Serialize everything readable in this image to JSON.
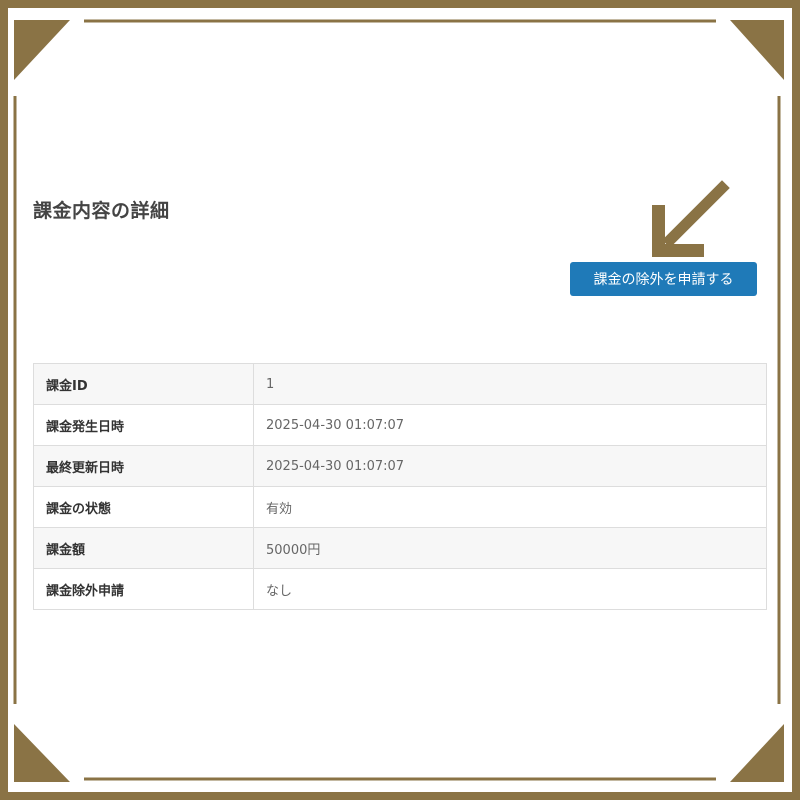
{
  "page": {
    "title": "課金内容の詳細"
  },
  "actions": {
    "request_exclusion_label": "課金の除外を申請する"
  },
  "details": {
    "rows": [
      {
        "label": "課金ID",
        "value": "1"
      },
      {
        "label": "課金発生日時",
        "value": "2025-04-30 01:07:07"
      },
      {
        "label": "最終更新日時",
        "value": "2025-04-30 01:07:07"
      },
      {
        "label": "課金の状態",
        "value": "有効"
      },
      {
        "label": "課金額",
        "value": "50000円"
      },
      {
        "label": "課金除外申請",
        "value": "なし"
      }
    ]
  },
  "colors": {
    "frame_gold": "#8a7345",
    "button_blue": "#1f7ab8",
    "arrow": "#8a7345"
  },
  "icons": {
    "arrow": "arrow-down-left-icon",
    "corner": "corner-triangle-ornament"
  }
}
